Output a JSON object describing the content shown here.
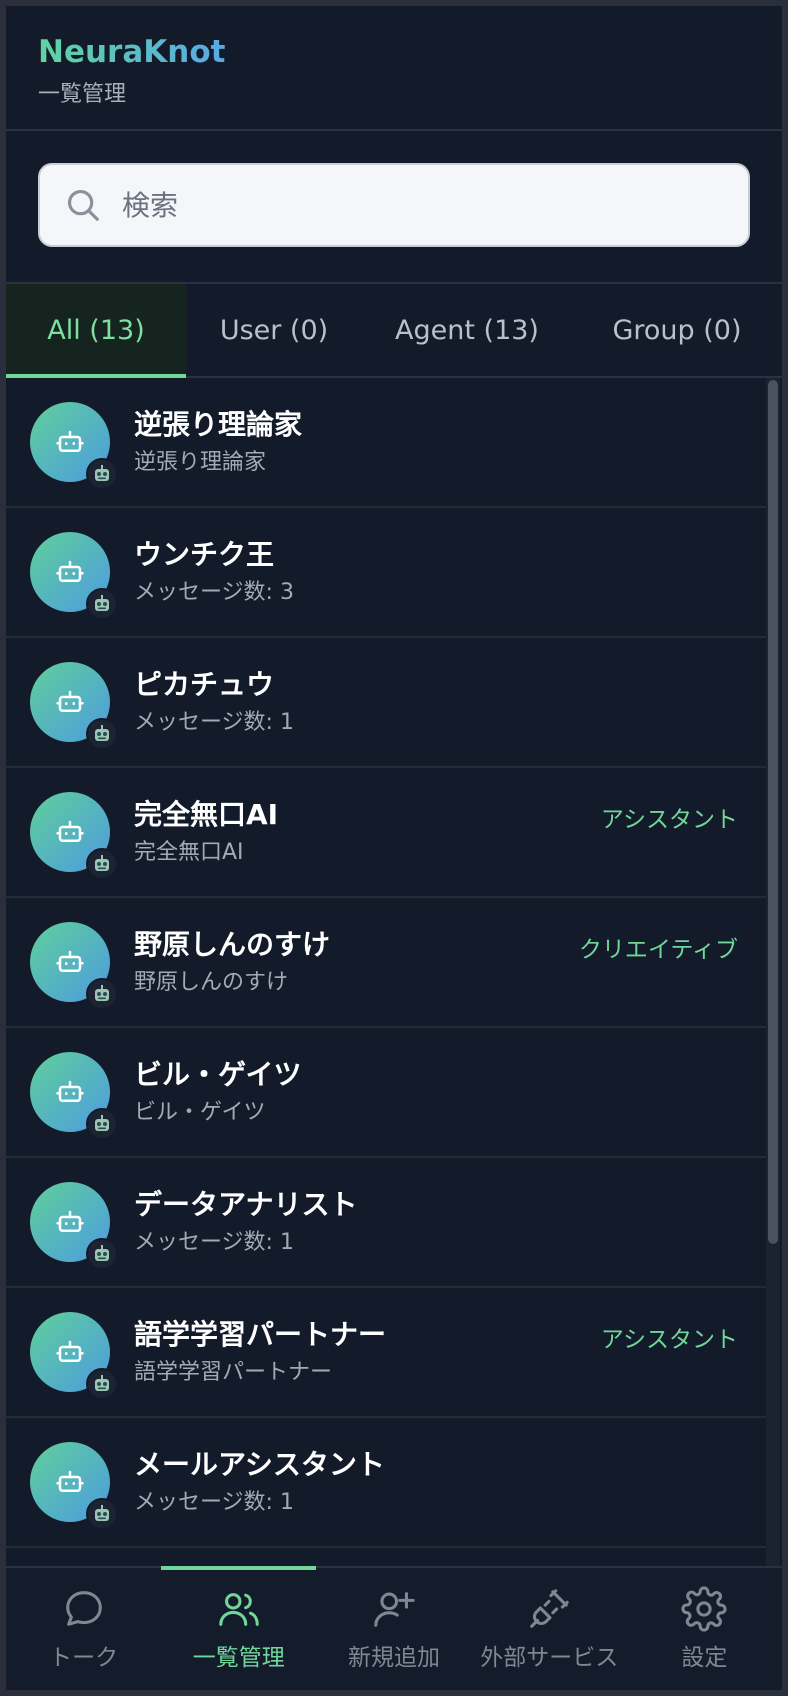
{
  "header": {
    "title": "NeuraKnot",
    "subtitle": "一覧管理"
  },
  "search": {
    "placeholder": "検索"
  },
  "tabs": [
    {
      "label": "All (13)",
      "active": true
    },
    {
      "label": "User (0)",
      "active": false
    },
    {
      "label": "Agent (13)",
      "active": false
    },
    {
      "label": "Group (0)",
      "active": false
    }
  ],
  "list": [
    {
      "name": "逆張り理論家",
      "sub": "逆張り理論家",
      "tag": ""
    },
    {
      "name": "ウンチク王",
      "sub": "メッセージ数: 3",
      "tag": ""
    },
    {
      "name": "ピカチュウ",
      "sub": "メッセージ数: 1",
      "tag": ""
    },
    {
      "name": "完全無口AI",
      "sub": "完全無口AI",
      "tag": "アシスタント"
    },
    {
      "name": "野原しんのすけ",
      "sub": "野原しんのすけ",
      "tag": "クリエイティブ"
    },
    {
      "name": "ビル・ゲイツ",
      "sub": "ビル・ゲイツ",
      "tag": ""
    },
    {
      "name": "データアナリスト",
      "sub": "メッセージ数: 1",
      "tag": ""
    },
    {
      "name": "語学学習パートナー",
      "sub": "語学学習パートナー",
      "tag": "アシスタント"
    },
    {
      "name": "メールアシスタント",
      "sub": "メッセージ数: 1",
      "tag": ""
    }
  ],
  "nav": [
    {
      "label": "トーク",
      "icon": "chat-icon",
      "active": false
    },
    {
      "label": "一覧管理",
      "icon": "users-icon",
      "active": true
    },
    {
      "label": "新規追加",
      "icon": "user-plus-icon",
      "active": false
    },
    {
      "label": "外部サービス",
      "icon": "plug-icon",
      "active": false
    },
    {
      "label": "設定",
      "icon": "gear-icon",
      "active": false
    }
  ],
  "colors": {
    "accent": "#6fd79a",
    "background": "#131a29",
    "text": "#ffffff",
    "muted": "#a3aab6"
  }
}
